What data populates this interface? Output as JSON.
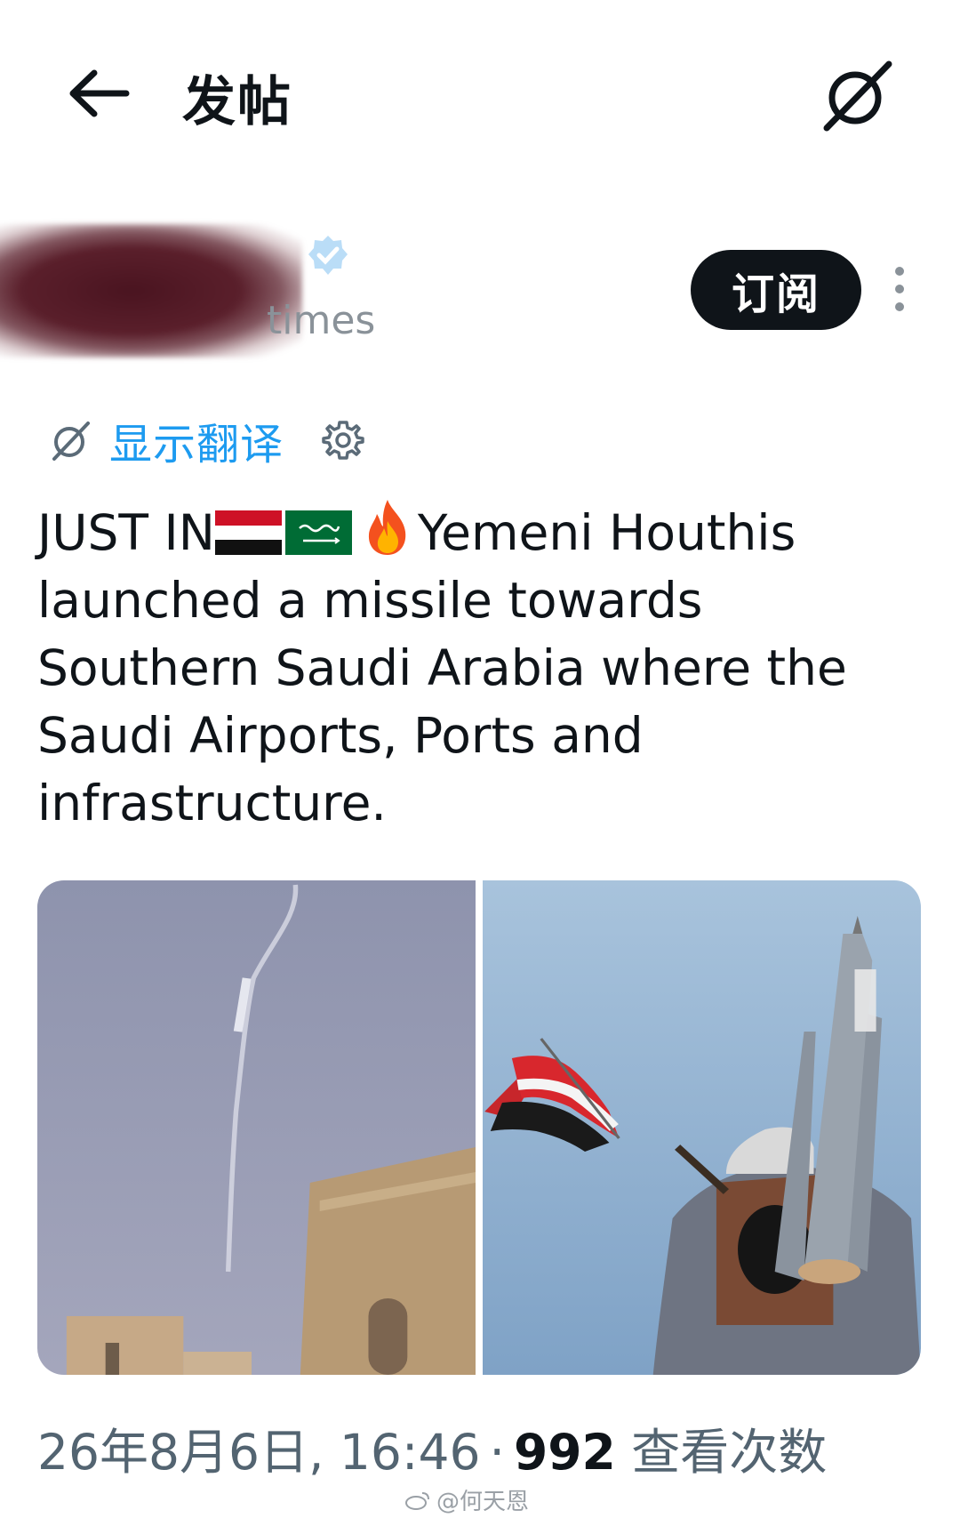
{
  "header": {
    "title": "发帖",
    "back_icon": "arrow-left-icon",
    "grok_icon": "grok-icon"
  },
  "author": {
    "name": "",
    "handle_visible": "times",
    "verified": true,
    "subscribe_label": "订阅"
  },
  "translate": {
    "label": "显示翻译"
  },
  "tweet": {
    "prefix": "JUST IN",
    "emojis": [
      "yemen-flag",
      "saudi-flag",
      "fire"
    ],
    "first_line_rest": "Yemeni Houthis",
    "body": "launched a missile towards Southern Saudi Arabia where the Saudi Airports, Ports and infrastructure."
  },
  "media": [
    {
      "description_icon": "missile-trail-photo"
    },
    {
      "description_icon": "houthi-fighter-photo"
    }
  ],
  "meta": {
    "date": "26年8月6日, 16:46",
    "separator": "·",
    "views": "992",
    "views_label": "查看次数"
  },
  "watermark": "@何天恩",
  "colors": {
    "accent": "#1d9bf0",
    "text": "#0f1419",
    "muted": "#536471"
  }
}
